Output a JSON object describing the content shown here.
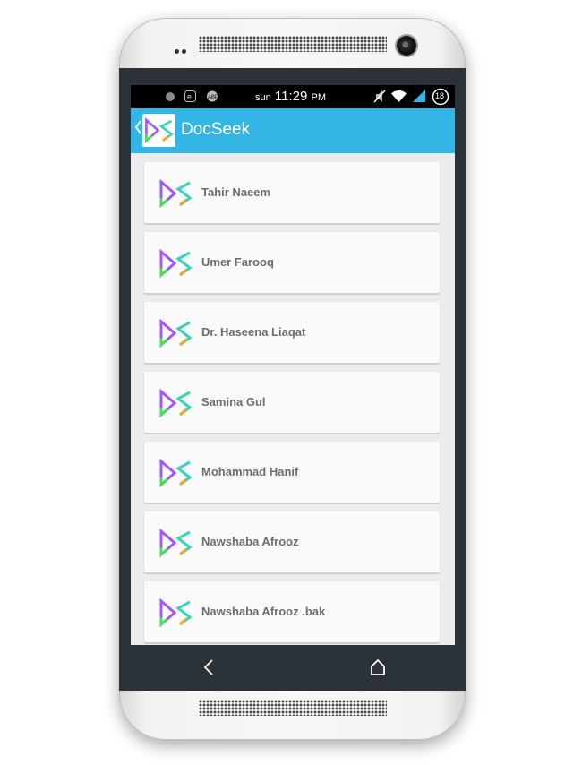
{
  "status_bar": {
    "day": "sun",
    "time": "11:29",
    "meridiem": "PM",
    "battery_level": "18",
    "icons": [
      "record-icon",
      "e-icon",
      "app-icon",
      "mute-icon",
      "wifi-icon",
      "signal-icon",
      "battery-icon"
    ]
  },
  "app_bar": {
    "title": "DocSeek",
    "back_icon": "chevron-left-icon"
  },
  "doctors": [
    {
      "name": "Tahir Naeem"
    },
    {
      "name": "Umer Farooq"
    },
    {
      "name": "Dr. Haseena Liaqat"
    },
    {
      "name": "Samina Gul"
    },
    {
      "name": "Mohammad Hanif"
    },
    {
      "name": "Nawshaba Afrooz"
    },
    {
      "name": "Nawshaba Afrooz .bak"
    }
  ],
  "nav_bar": {
    "buttons": [
      "back-icon",
      "home-icon"
    ]
  },
  "colors": {
    "app_bar": "#33b5e5",
    "background": "#ececec",
    "card": "#fafafa",
    "text": "#6d6d6d",
    "logo_purple": "#a259f7",
    "logo_green": "#4cd964",
    "logo_teal": "#37d3c0",
    "logo_orange": "#f5a623"
  }
}
